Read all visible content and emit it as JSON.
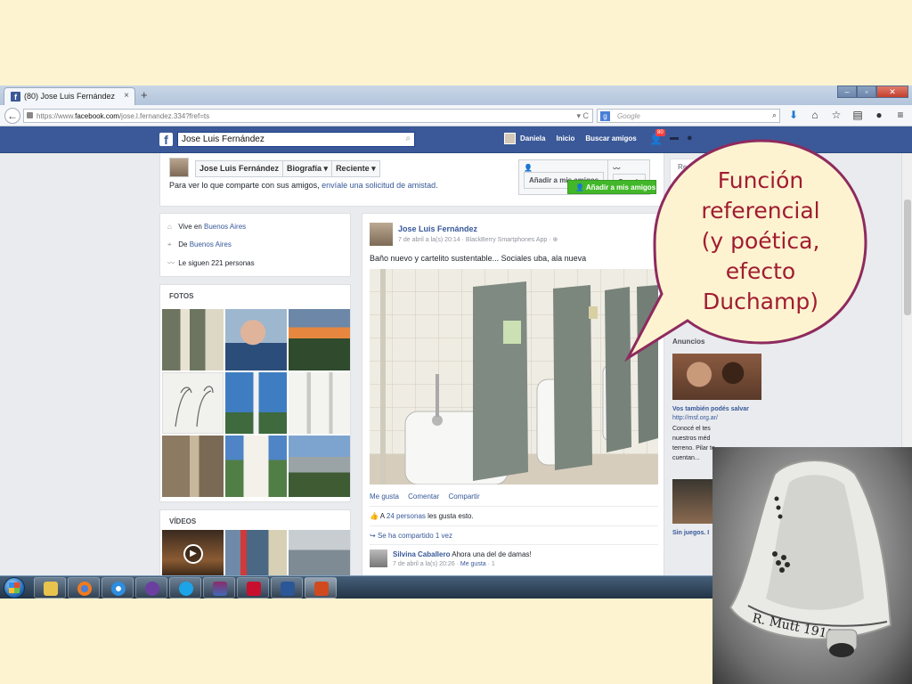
{
  "browser": {
    "tab_title": "(80) Jose Luis Fernández",
    "tab_close": "×",
    "new_tab": "+",
    "url_prefix": "https://www.",
    "url_domain": "facebook.com",
    "url_path": "/jose.l.fernandez.334?fref=ts",
    "search_placeholder": "Google"
  },
  "facebook": {
    "search_value": "Jose Luis Fernández",
    "nav": {
      "user": "Daniela",
      "home": "Inicio",
      "find_friends": "Buscar amigos"
    },
    "notifications_count": "80",
    "timeline": {
      "name_tab": "Jose Luis Fernández",
      "bio_tab": "Biografía ▾",
      "recent_tab": "Reciente ▾",
      "add_friend": "Añadir a mis amigos",
      "follow": "Seguir",
      "message": "Para ver lo que comparte con sus amigos, ",
      "message_link": "envíale una solicitud de amistad.",
      "add_friend_green": "Añadir a mis amigos"
    },
    "about": {
      "lives_prefix": "Vive en ",
      "lives_link": "Buenos Aires",
      "from_prefix": "De ",
      "from_link": "Buenos Aires",
      "followers": "Le siguen 221 personas"
    },
    "photos_title": "FOTOS",
    "videos_title": "VÍDEOS",
    "post": {
      "author": "Jose Luis Fernández",
      "meta": "7 de abril a la(s) 20:14 · BlackBerry Smartphones App · ⊕",
      "text": "Baño nuevo y cartelito sustentable... Sociales uba, ala nueva",
      "actions": [
        "Me gusta",
        "Comentar",
        "Compartir"
      ],
      "likes_prefix": "A ",
      "likes_link": "24 personas",
      "likes_suffix": " les gusta esto.",
      "shares": "Se ha compartido 1 vez",
      "comment_author": "Silvina Caballero",
      "comment_text": " Ahora una del de damas!",
      "comment_meta_time": "7 de abril a la(s) 20:26 · ",
      "comment_meta_like": "Me gusta",
      "comment_meta_count": " · 1"
    },
    "right": {
      "box_label": "Rec",
      "ads_title": "Anuncios",
      "ad_title": "Vos también podés salvar",
      "ad_url": "http://msf.org.ar/",
      "ad_body": "Conocé el tes nuestros méd terreno. Pilar te cuentan...",
      "ad2_title": "Sin juegos. I"
    }
  },
  "annotation": {
    "bubble_lines": [
      "Función",
      "referencial",
      "(y poética,",
      "efecto",
      "Duchamp)"
    ]
  },
  "colors": {
    "slide_bg": "#fdf3d0",
    "fb_blue": "#3b5998",
    "link": "#365899",
    "bubble_border": "#8e2a5e",
    "bubble_text": "#a11c32"
  }
}
